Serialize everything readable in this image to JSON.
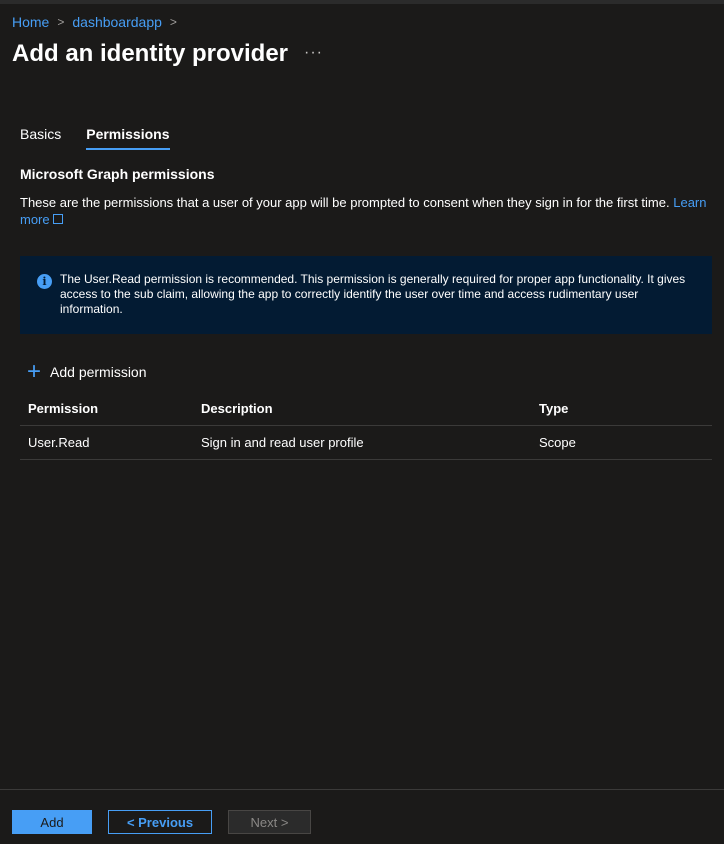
{
  "breadcrumb": {
    "home": "Home",
    "app": "dashboardapp",
    "sep": ">"
  },
  "page": {
    "title": "Add an identity provider",
    "more": "···"
  },
  "tabs": [
    {
      "label": "Basics",
      "active": false
    },
    {
      "label": "Permissions",
      "active": true
    }
  ],
  "section": {
    "title": "Microsoft Graph permissions",
    "description": "These are the permissions that a user of your app will be prompted to consent when they sign in for the first time.",
    "learn_more_1": "Learn",
    "learn_more_2": "more"
  },
  "info": {
    "icon": "i",
    "text": "The User.Read permission is recommended. This permission is generally required for proper app functionality. It gives access to the sub claim, allowing the app to correctly identify the user over time and access rudimentary user information."
  },
  "add_permission": {
    "icon": "+",
    "label": "Add permission"
  },
  "table": {
    "headers": {
      "permission": "Permission",
      "description": "Description",
      "type": "Type"
    },
    "rows": [
      {
        "permission": "User.Read",
        "description": "Sign in and read user profile",
        "type": "Scope"
      }
    ]
  },
  "footer": {
    "add": "Add",
    "previous": "< Previous",
    "next": "Next >"
  },
  "colors": {
    "accent": "#479ef5",
    "background": "#1b1a19",
    "info_background": "#031b33"
  }
}
